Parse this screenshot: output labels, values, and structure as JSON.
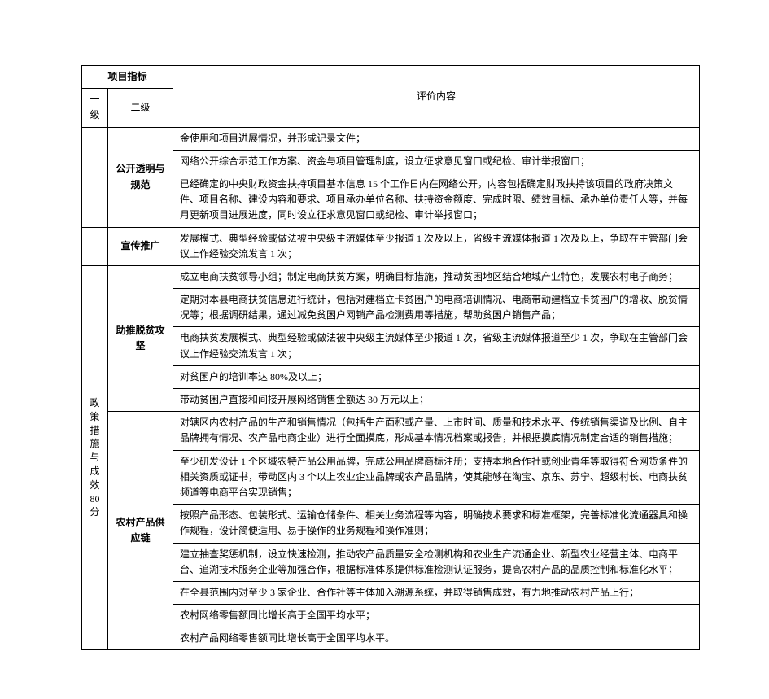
{
  "header": {
    "project_indicator": "项目指标",
    "level1": "一级",
    "level2": "二级",
    "evaluation_content": "评价内容"
  },
  "vertical_label": {
    "lines": [
      "政",
      "策",
      "措",
      "施",
      "与",
      "成",
      "效",
      "80",
      "分"
    ]
  },
  "sections": [
    {
      "level2": "公开透明与规范",
      "rows": [
        "金使用和项目进展情况，并形成记录文件；",
        "网络公开综合示范工作方案、资金与项目管理制度，设立征求意见窗口或纪检、审计举报窗口；",
        "已经确定的中央财政资金扶持项目基本信息 15 个工作日内在网络公开，内容包括确定财政扶持该项目的政府决策文件、项目名称、建设内容和要求、项目承办单位名称、扶持资金额度、完成时限、绩效目标、承办单位责任人等，并每月更新项目进展进度，同时设立征求意见窗口或纪检、审计举报窗口；"
      ]
    },
    {
      "level2": "宣传推广",
      "rows": [
        "发展模式、典型经验或做法被中央级主流媒体至少报道 1 次及以上，省级主流媒体报道 1 次及以上，争取在主管部门会议上作经验交流发言 1 次；"
      ]
    },
    {
      "level2": "助推脱贫攻坚",
      "rows": [
        "成立电商扶贫领导小组；制定电商扶贫方案，明确目标措施，推动贫困地区结合地域产业特色，发展农村电子商务；",
        "定期对本县电商扶贫信息进行统计，包括对建档立卡贫困户的电商培训情况、电商带动建档立卡贫困户的增收、脱贫情况等；根据调研结果，通过减免贫困户网销产品检测费用等措施，帮助贫困户销售产品；",
        "电商扶贫发展模式、典型经验或做法被中央级主流媒体至少报道 1 次，省级主流媒体报道至少 1 次，争取在主管部门会议上作经验交流发言 1 次；",
        "对贫困户的培训率达 80%及以上；",
        "带动贫困户直接和间接开展网络销售金额达 30 万元以上；"
      ]
    },
    {
      "level2": "农村产品供应链",
      "rows": [
        "对辖区内农村产品的生产和销售情况（包括生产面积或产量、上市时间、质量和技术水平、传统销售渠道及比例、自主品牌拥有情况、农产品电商企业）进行全面摸底，形成基本情况档案或报告，并根据摸底情况制定合适的销售措施；",
        "至少研发设计 1 个区域农特产品公用品牌，完成公用品牌商标注册；支持本地合作社或创业青年等取得符合网货条件的相关资质或证书，带动区内 3 个以上农业企业品牌或农产品品牌，使其能够在淘宝、京东、苏宁、超级村长、电商扶贫频道等电商平台实现销售；",
        "按照产品形态、包装形式、运输仓储条件、相关业务流程等内容，明确技术要求和标准框架，完善标准化流通器具和操作规程，设计简便适用、易于操作的业务规程和操作准则；",
        "建立抽查奖惩机制，设立快速检测，推动农产品质量安全检测机构和农业生产流通企业、新型农业经营主体、电商平台、追溯技术服务企业等加强合作，根据标准体系提供标准检测认证服务，提高农村产品的品质控制和标准化水平；",
        "在全县范围内对至少 3 家企业、合作社等主体加入溯源系统，并取得销售成效，有力地推动农村产品上行；",
        "农村网络零售额同比增长高于全国平均水平；",
        "农村产品网络零售额同比增长高于全国平均水平。"
      ]
    }
  ]
}
